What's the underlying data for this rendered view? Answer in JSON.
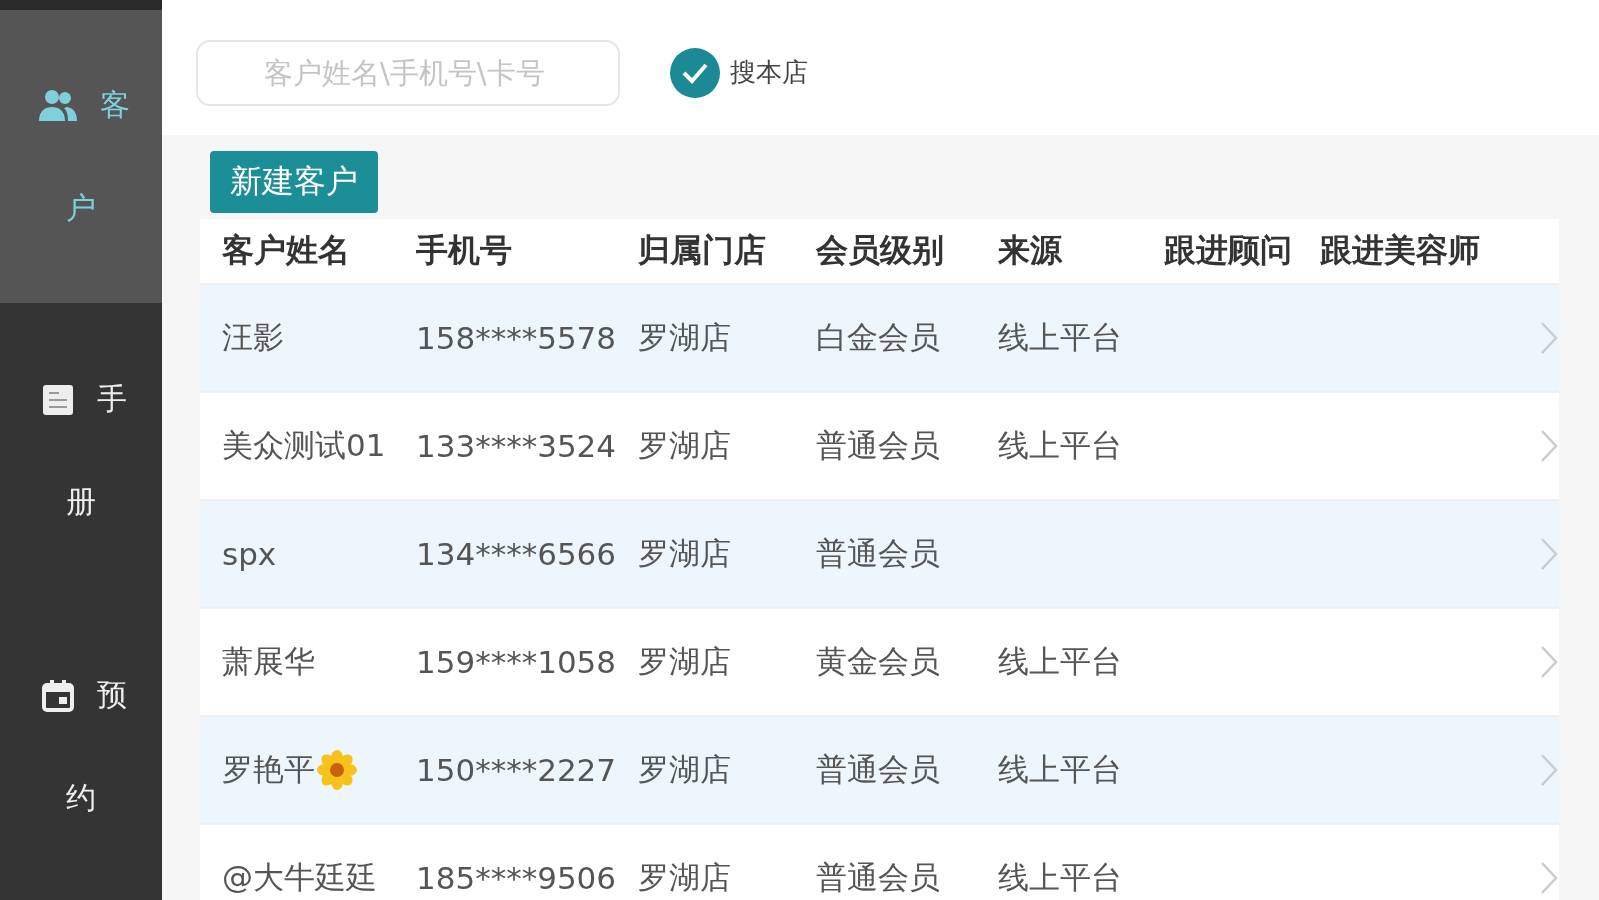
{
  "sidebar": {
    "items": [
      {
        "kind": "people",
        "label_top": "客",
        "label_bottom": "户",
        "selected": true
      },
      {
        "kind": "book",
        "label_top": "手",
        "label_bottom": "册",
        "selected": false
      },
      {
        "kind": "calendar",
        "label_top": "预",
        "label_bottom": "约",
        "selected": false
      }
    ]
  },
  "search": {
    "placeholder": "客户姓名\\手机号\\卡号"
  },
  "store_filter": {
    "label": "搜本店",
    "checked": true
  },
  "new_customer_button": "新建客户",
  "table": {
    "columns": [
      "客户姓名",
      "手机号",
      "归属门店",
      "会员级别",
      "来源",
      "跟进顾问",
      "跟进美容师"
    ],
    "rows": [
      {
        "cells": [
          "汪影",
          "158****5578",
          "罗湖店",
          "白金会员",
          "线上平台",
          "",
          ""
        ],
        "flower_badge": false
      },
      {
        "cells": [
          "美众测试01",
          "133****3524",
          "罗湖店",
          "普通会员",
          "线上平台",
          "",
          ""
        ],
        "flower_badge": false
      },
      {
        "cells": [
          "spx",
          "134****6566",
          "罗湖店",
          "普通会员",
          "",
          "",
          ""
        ],
        "flower_badge": false
      },
      {
        "cells": [
          "萧展华",
          "159****1058",
          "罗湖店",
          "黄金会员",
          "线上平台",
          "",
          ""
        ],
        "flower_badge": false
      },
      {
        "cells": [
          "罗艳平",
          "150****2227",
          "罗湖店",
          "普通会员",
          "线上平台",
          "",
          ""
        ],
        "flower_badge": true
      },
      {
        "cells": [
          "@大牛廷廷",
          "185****9506",
          "罗湖店",
          "普通会员",
          "线上平台",
          "",
          ""
        ],
        "flower_badge": false
      }
    ]
  }
}
